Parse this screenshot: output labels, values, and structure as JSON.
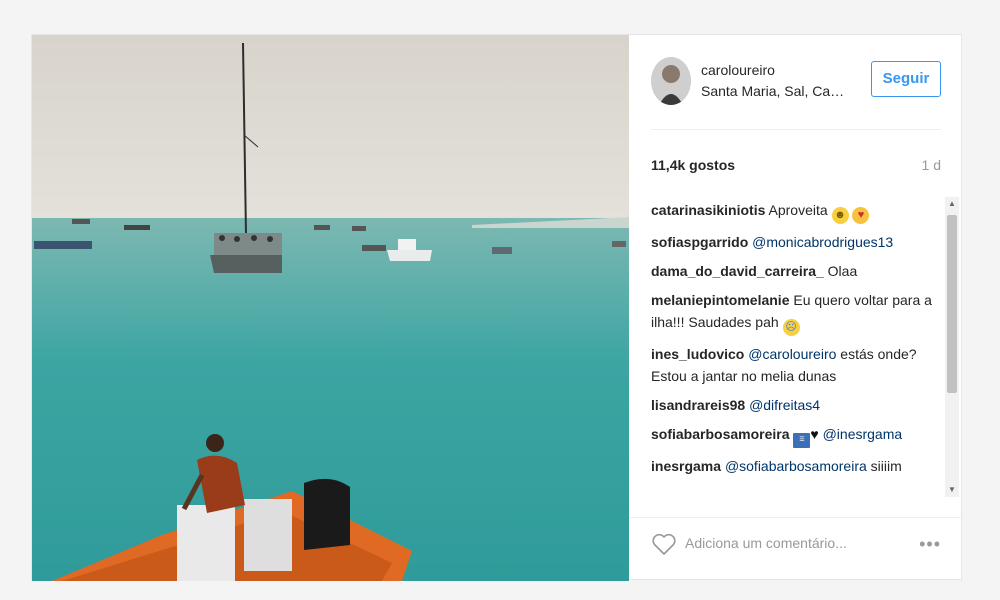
{
  "post": {
    "username": "caroloureiro",
    "location": "Santa Maria, Sal, Cabo Verde",
    "follow_label": "Seguir",
    "likes": "11,4k gostos",
    "time_ago": "1 d",
    "comment_placeholder": "Adiciona um comentário...",
    "more_icon": "more-options-icon",
    "like_icon": "heart-outline-icon"
  },
  "comments": [
    {
      "user": "catarinasikiniotis",
      "text": "Aproveita",
      "emoji": [
        "slightly-smiling-face",
        "face-blowing-kiss"
      ]
    },
    {
      "user": "sofiaspgarrido",
      "mention": "@monicabrodrigues13",
      "text": ""
    },
    {
      "user": "dama_do_david_carreira_",
      "text": "Olaa"
    },
    {
      "user": "melaniepintomelanie",
      "text": "Eu quero voltar para a ilha!!! Saudades pah",
      "emoji": [
        "crying-face"
      ]
    },
    {
      "user": "ines_ludovico",
      "mention": "@caroloureiro",
      "text": "estás onde? Estou a jantar no melia dunas"
    },
    {
      "user": "lisandrareis98",
      "mention": "@difreitas4",
      "text": ""
    },
    {
      "user": "sofiabarbosamoreira",
      "mention": "@inesrgama",
      "text": "",
      "emoji": [
        "newspaper",
        "black-heart"
      ]
    },
    {
      "user": "inesrgama",
      "mention": "@sofiabarbosamoreira",
      "text": "siiiim"
    }
  ],
  "colors": {
    "accent": "#3897f0",
    "mention": "#003569",
    "muted": "#999999",
    "text": "#262626"
  }
}
